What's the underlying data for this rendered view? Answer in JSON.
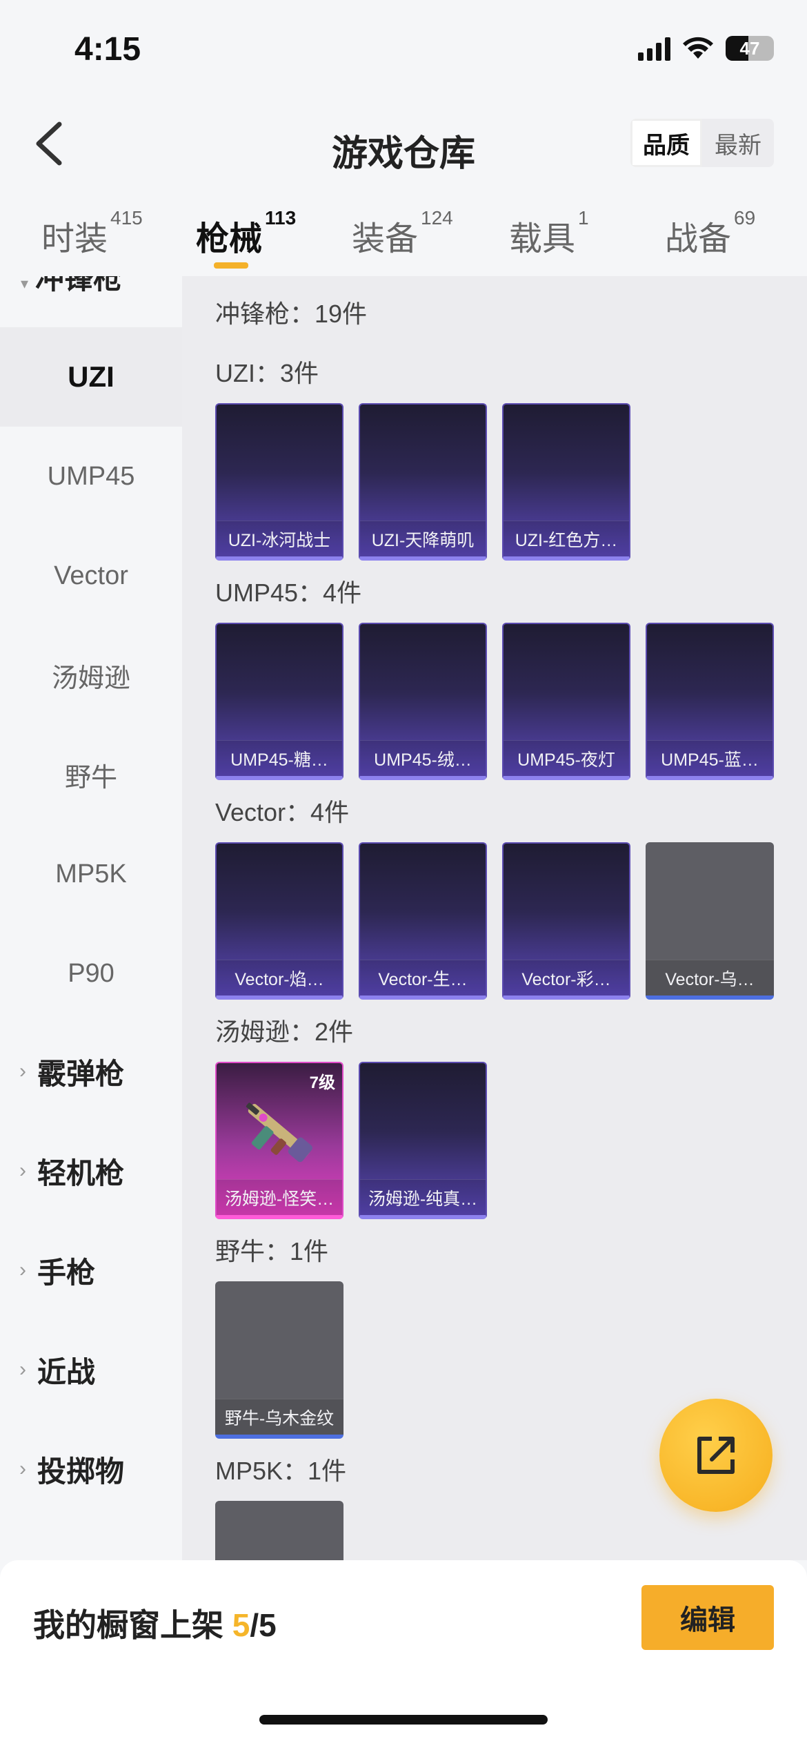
{
  "status": {
    "time": "4:15",
    "battery": "47",
    "battery_level": 0.47
  },
  "header": {
    "title": "游戏仓库",
    "sort_options": [
      "品质",
      "最新"
    ],
    "sort_active": "品质"
  },
  "tabs": [
    {
      "label": "时装",
      "count": "415"
    },
    {
      "label": "枪械",
      "count": "113"
    },
    {
      "label": "装备",
      "count": "124"
    },
    {
      "label": "载具",
      "count": "1"
    },
    {
      "label": "战备",
      "count": "69"
    }
  ],
  "sidebar": {
    "partial_category": "冲锋枪",
    "subitems": [
      "UZI",
      "UMP45",
      "Vector",
      "汤姆逊",
      "野牛",
      "MP5K",
      "P90"
    ],
    "active_subitem": "UZI",
    "categories": [
      "霰弹枪",
      "轻机枪",
      "手枪",
      "近战",
      "投掷物"
    ]
  },
  "content": {
    "header": "冲锋枪：19件",
    "sections": [
      {
        "label": "UZI：3件",
        "items": [
          {
            "name": "UZI-冰河战士",
            "style": "purple"
          },
          {
            "name": "UZI-天降萌叽",
            "style": "purple"
          },
          {
            "name": "UZI-红色方…",
            "style": "purple"
          }
        ]
      },
      {
        "label": "UMP45：4件",
        "items": [
          {
            "name": "UMP45-糖…",
            "style": "purple"
          },
          {
            "name": "UMP45-绒…",
            "style": "purple"
          },
          {
            "name": "UMP45-夜灯",
            "style": "purple"
          },
          {
            "name": "UMP45-蓝…",
            "style": "purple"
          }
        ]
      },
      {
        "label": "Vector：4件",
        "items": [
          {
            "name": "Vector-焰…",
            "style": "purple"
          },
          {
            "name": "Vector-生…",
            "style": "purple"
          },
          {
            "name": "Vector-彩…",
            "style": "purple"
          },
          {
            "name": "Vector-乌…",
            "style": "gray"
          }
        ]
      },
      {
        "label": "汤姆逊：2件",
        "items": [
          {
            "name": "汤姆逊-怪笑…",
            "style": "pink",
            "level": "7级"
          },
          {
            "name": "汤姆逊-纯真…",
            "style": "purple"
          }
        ]
      },
      {
        "label": "野牛：1件",
        "items": [
          {
            "name": "野牛-乌木金纹",
            "style": "gray"
          }
        ]
      },
      {
        "label": "MP5K：1件",
        "items": [
          {
            "name": "",
            "style": "gray"
          }
        ]
      }
    ]
  },
  "bottom": {
    "shelf_label": "我的橱窗上架",
    "shelf_count": "5",
    "shelf_total": "/5",
    "edit_label": "编辑"
  },
  "colors": {
    "accent": "#f6ad2a",
    "purple_rarity": "#5a47b8",
    "pink_rarity": "#e23fc0",
    "gray_rarity": "#5e5e64"
  }
}
